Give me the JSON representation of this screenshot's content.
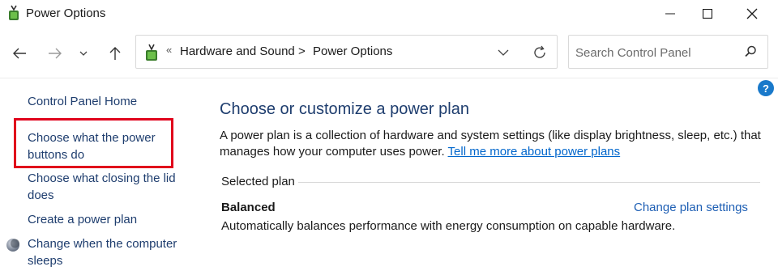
{
  "window": {
    "title": "Power Options"
  },
  "navigation": {
    "breadcrumb_prefix": "«",
    "breadcrumbs": [
      "Hardware and Sound",
      "Power Options"
    ],
    "breadcrumb_separator": ">",
    "search_placeholder": "Search Control Panel"
  },
  "sidebar": {
    "items": [
      {
        "label": "Control Panel Home"
      },
      {
        "label": "Choose what the power buttons do",
        "highlighted": true
      },
      {
        "label": "Choose what closing the lid does"
      },
      {
        "label": "Create a power plan"
      },
      {
        "label": "Change when the computer sleeps",
        "icon": "moon-icon"
      }
    ]
  },
  "main": {
    "title": "Choose or customize a power plan",
    "intro_text": "A power plan is a collection of hardware and system settings (like display brightness, sleep, etc.) that manages how your computer uses power. ",
    "intro_link": "Tell me more about power plans",
    "selected_plan_label": "Selected plan",
    "plan": {
      "name": "Balanced",
      "description": "Automatically balances performance with energy consumption on capable hardware.",
      "settings_link": "Change plan settings"
    }
  },
  "help": {
    "symbol": "?"
  },
  "colors": {
    "link": "#1e3d6e",
    "hyperlink": "#0066cc",
    "highlight": "#e0001b",
    "help": "#1979ca"
  }
}
